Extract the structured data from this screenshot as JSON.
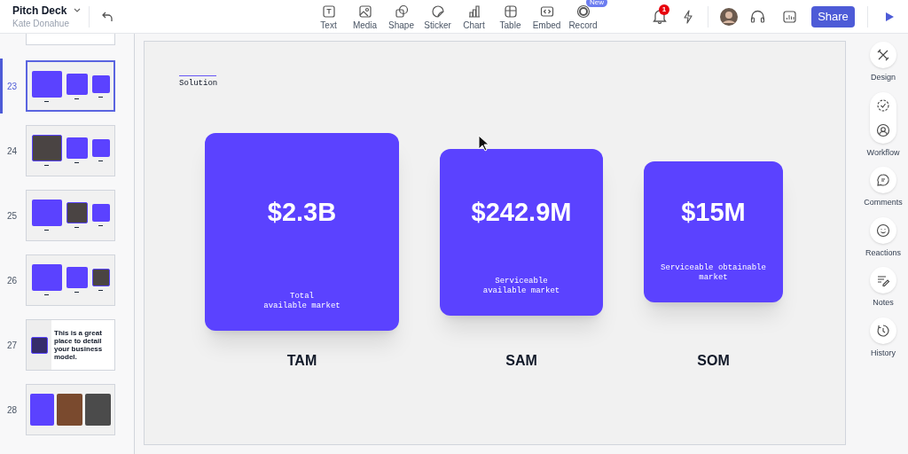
{
  "header": {
    "title": "Pitch Deck",
    "subtitle": "Kate Donahue"
  },
  "toolbar": [
    {
      "kind": "text",
      "label": "Text"
    },
    {
      "kind": "media",
      "label": "Media"
    },
    {
      "kind": "shape",
      "label": "Shape"
    },
    {
      "kind": "sticker",
      "label": "Sticker"
    },
    {
      "kind": "chart",
      "label": "Chart"
    },
    {
      "kind": "table",
      "label": "Table"
    },
    {
      "kind": "embed",
      "label": "Embed"
    },
    {
      "kind": "record",
      "label": "Record",
      "badge": "New"
    }
  ],
  "notifications": {
    "count": "1"
  },
  "share_button": "Share",
  "slides": [
    {
      "number": "23",
      "kind": "market",
      "tiles": [
        {
          "kind": "card"
        },
        {
          "kind": "card"
        },
        {
          "kind": "card"
        }
      ],
      "selected": true
    },
    {
      "number": "24",
      "kind": "market",
      "tiles": [
        {
          "kind": "photo"
        },
        {
          "kind": "card"
        },
        {
          "kind": "card"
        }
      ],
      "selected": false
    },
    {
      "number": "25",
      "kind": "market",
      "tiles": [
        {
          "kind": "card"
        },
        {
          "kind": "photo"
        },
        {
          "kind": "card"
        }
      ],
      "selected": false
    },
    {
      "number": "26",
      "kind": "market",
      "tiles": [
        {
          "kind": "card"
        },
        {
          "kind": "card"
        },
        {
          "kind": "photo"
        }
      ],
      "selected": false
    },
    {
      "number": "27",
      "kind": "text",
      "text": "This is a great place to detail your business model.",
      "selected": false
    },
    {
      "number": "28",
      "kind": "cards",
      "selected": false
    }
  ],
  "slide": {
    "heading": "Solution",
    "cards": [
      {
        "value": "$2.3B",
        "caption": "Total\navailable market",
        "label": "TAM"
      },
      {
        "value": "$242.9M",
        "caption": "Serviceable\navailable market",
        "label": "SAM"
      },
      {
        "value": "$15M",
        "caption": "Serviceable obtainable\nmarket",
        "label": "SOM"
      }
    ]
  },
  "rail": [
    {
      "kind": "design",
      "label": "Design"
    },
    {
      "kind": "workflow",
      "label": "Workflow"
    },
    {
      "kind": "comments",
      "label": "Comments"
    },
    {
      "kind": "reactions",
      "label": "Reactions"
    },
    {
      "kind": "notes",
      "label": "Notes"
    },
    {
      "kind": "history",
      "label": "History"
    }
  ]
}
